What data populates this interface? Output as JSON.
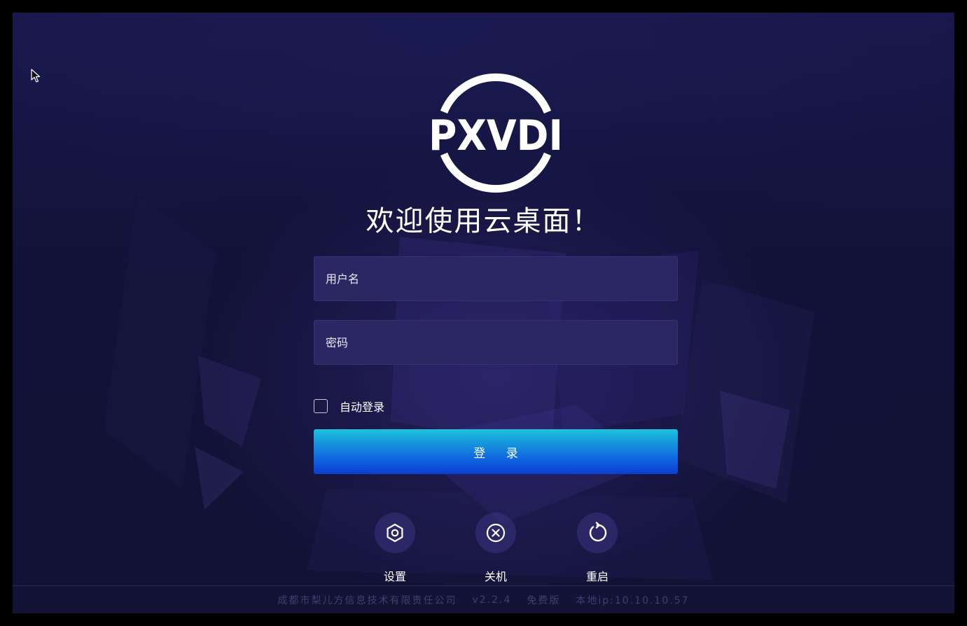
{
  "login": {
    "logo_text": "PXVDI",
    "welcome": "欢迎使用云桌面！",
    "username_placeholder": "用户名",
    "password_placeholder": "密码",
    "username_value": "",
    "password_value": "",
    "auto_login_label": "自动登录",
    "auto_login_checked": false,
    "login_button": "登 录"
  },
  "actions": [
    {
      "label": "设置",
      "icon": "settings-icon"
    },
    {
      "label": "关机",
      "icon": "shutdown-icon"
    },
    {
      "label": "重启",
      "icon": "restart-icon"
    }
  ],
  "footer": {
    "company": "成都市梨儿方信息技术有限责任公司",
    "version": "v2.2.4",
    "edition": "免费版",
    "local_ip": "本地ip:10.10.10.57"
  },
  "colors": {
    "background": "#141440",
    "field_background": "#2a2762",
    "button_gradient_top": "#1ec3dc",
    "button_gradient_bottom": "#0a3fcf",
    "footer_text": "#3e3e72"
  }
}
